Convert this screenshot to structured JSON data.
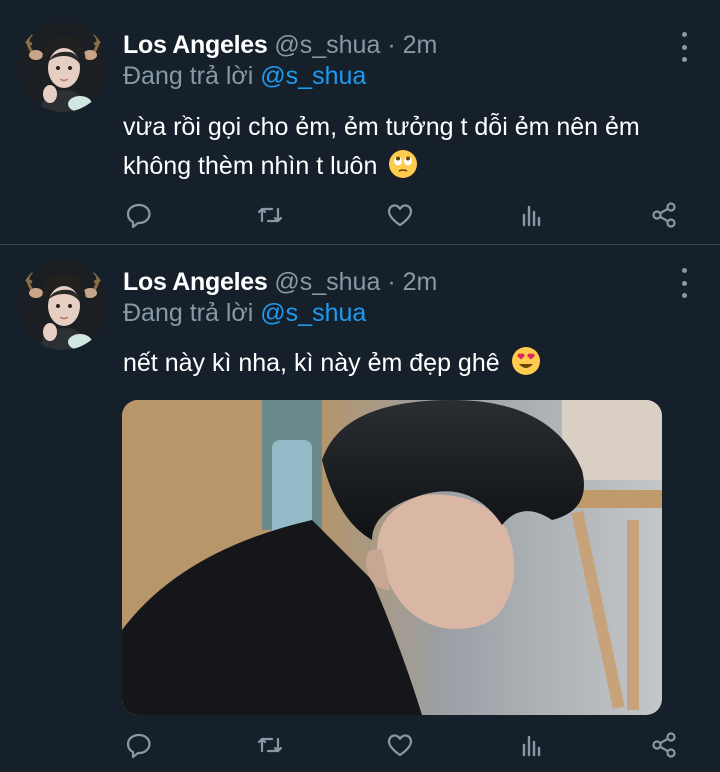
{
  "tweets": [
    {
      "author": {
        "name": "Los Angeles",
        "handle": "@s_shua"
      },
      "separator": "·",
      "time": "2m",
      "reply_prefix": "Đang trả lời",
      "reply_to": "@s_shua",
      "text": "vừa rồi gọi cho ẻm, ẻm tưởng t dỗi ẻm nên ẻm không thèm nhìn t luôn",
      "emoji": "face-with-rolling-eyes",
      "actions": [
        "reply-icon",
        "retweet-icon",
        "like-icon",
        "analytics-icon",
        "share-icon"
      ]
    },
    {
      "author": {
        "name": "Los Angeles",
        "handle": "@s_shua"
      },
      "separator": "·",
      "time": "2m",
      "reply_prefix": "Đang trả lời",
      "reply_to": "@s_shua",
      "text": "nết này kì nha, kì này ẻm đẹp ghê",
      "emoji": "smiling-face-with-heart-eyes",
      "media": {
        "kind": "photo",
        "subject": "dark-haired young man in black shirt looking down"
      },
      "actions": [
        "reply-icon",
        "retweet-icon",
        "like-icon",
        "analytics-icon",
        "share-icon"
      ]
    }
  ],
  "colors": {
    "background": "#15202b",
    "text": "#ffffff",
    "secondary": "#8899a6",
    "link": "#1d9bf0",
    "divider": "#38444d"
  }
}
